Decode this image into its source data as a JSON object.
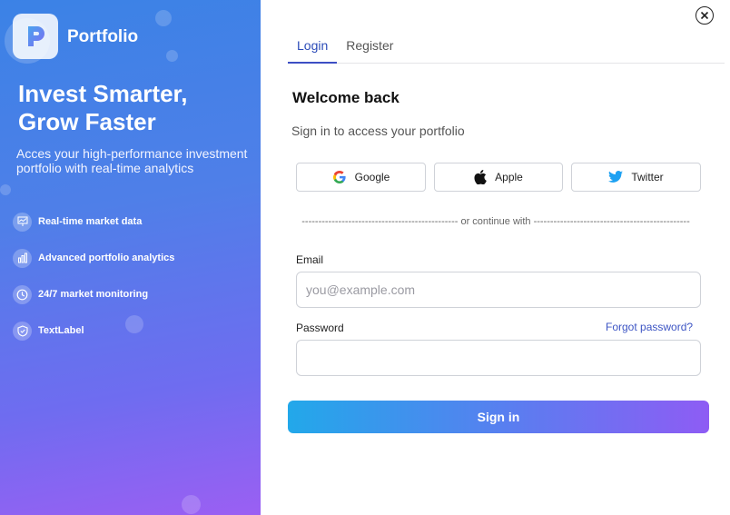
{
  "brand": {
    "name": "Portfolio",
    "logo_letter": "P"
  },
  "hero": {
    "headline_line1": "Invest Smarter,",
    "headline_line2": "Grow Faster",
    "subline": "Acces your high-performance investment\n portfolio with real-time analytics"
  },
  "features": [
    {
      "label": "Real-time market data",
      "icon": "chart-icon"
    },
    {
      "label": "Advanced portfolio analytics",
      "icon": "bar-chart-icon"
    },
    {
      "label": "24/7 market monitoring",
      "icon": "clock-icon"
    },
    {
      "label": "TextLabel",
      "icon": "shield-icon"
    }
  ],
  "tabs": [
    {
      "label": "Login",
      "active": true
    },
    {
      "label": "Register",
      "active": false
    }
  ],
  "login": {
    "title": "Welcome back",
    "subtitle": "Sign in to access your portfolio",
    "social": [
      {
        "label": "Google",
        "icon": "google-icon"
      },
      {
        "label": "Apple",
        "icon": "apple-icon"
      },
      {
        "label": "Twitter",
        "icon": "twitter-icon"
      }
    ],
    "divider": "----------------------------------------------- or continue with -----------------------------------------------",
    "email_label": "Email",
    "email_placeholder": "you@example.com",
    "email_value": "",
    "password_label": "Password",
    "password_value": "",
    "forgot_label": "Forgot password?",
    "submit_label": "Sign in"
  },
  "colors": {
    "accent": "#3d4fc4",
    "gradient_start": "#22a8ea",
    "gradient_end": "#8e5cf4"
  }
}
